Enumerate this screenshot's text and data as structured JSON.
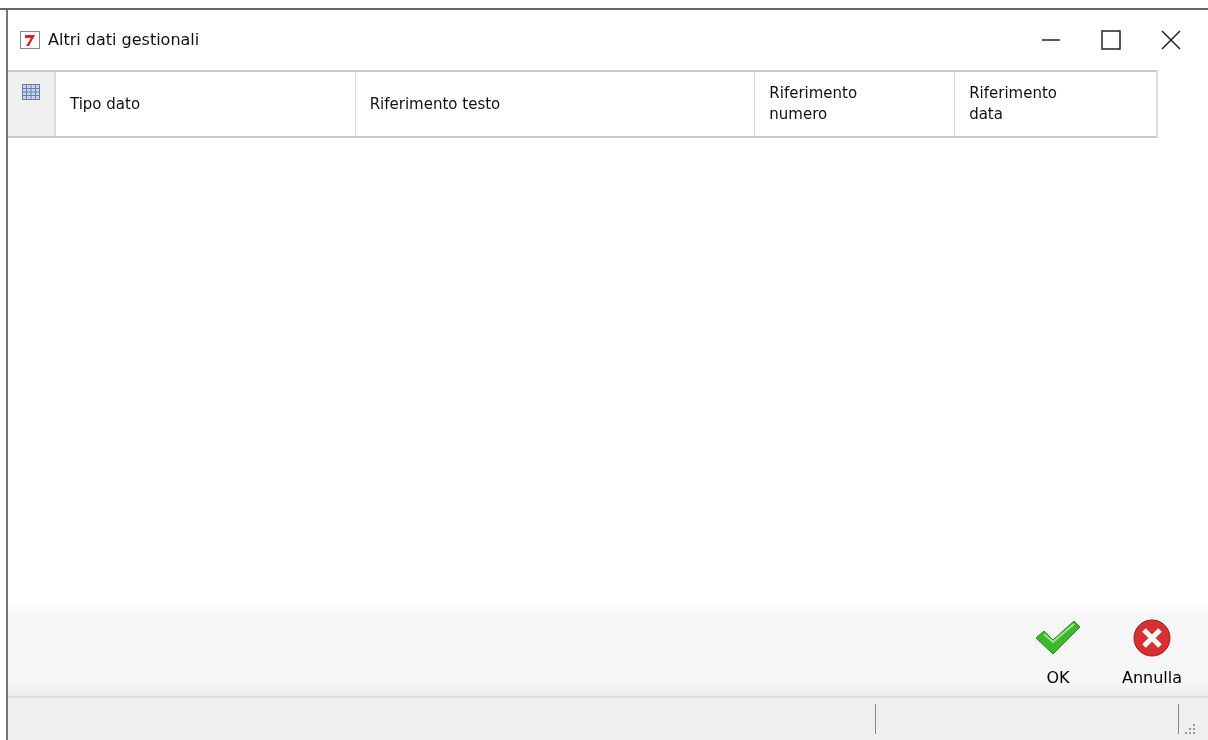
{
  "window": {
    "title": "Altri dati gestionali"
  },
  "table": {
    "columns": [
      {
        "label": "Tipo dato"
      },
      {
        "label": "Riferimento testo"
      },
      {
        "label": "Riferimento numero"
      },
      {
        "label": "Riferimento data"
      }
    ]
  },
  "buttons": [
    {
      "kind": "ok",
      "label": "OK"
    },
    {
      "kind": "cancel",
      "label": "Annulla"
    }
  ]
}
